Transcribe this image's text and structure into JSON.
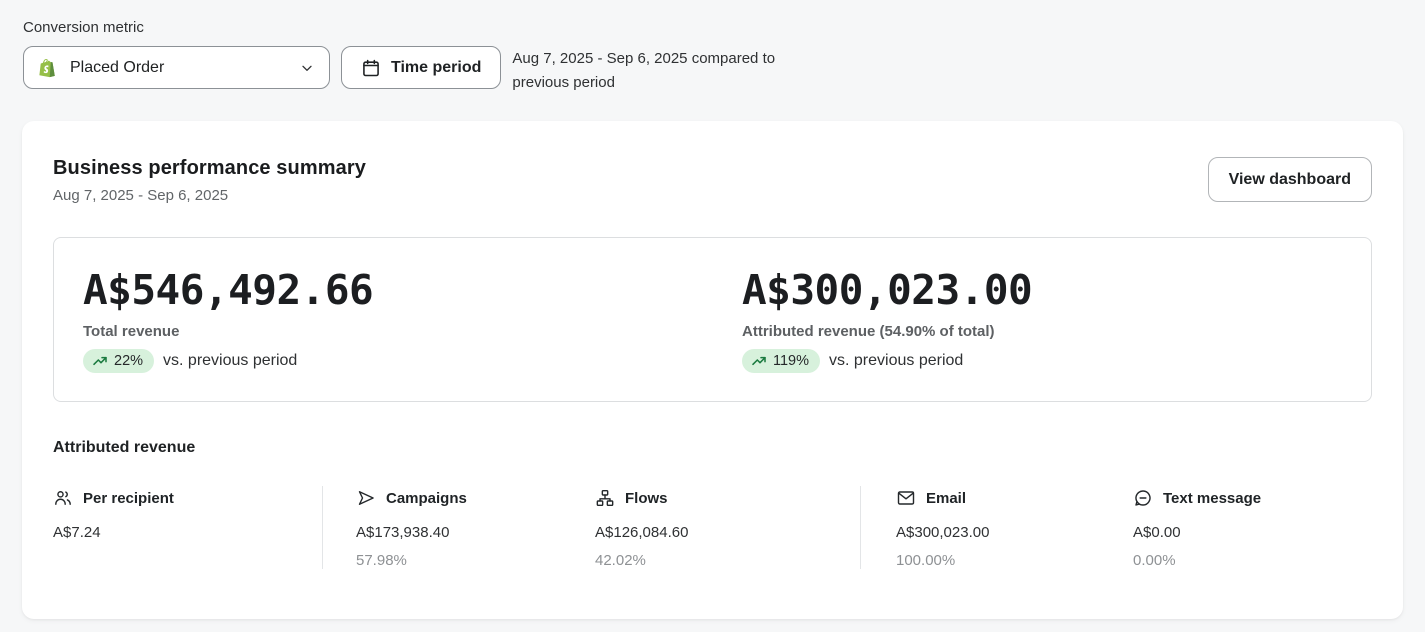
{
  "controls": {
    "label": "Conversion metric",
    "metric_dropdown": {
      "value": "Placed Order",
      "icon": "shopify-icon"
    },
    "time_period_button": {
      "label": "Time period",
      "icon": "calendar-icon"
    },
    "date_range_text": "Aug 7, 2025 - Sep 6, 2025 compared to previous period"
  },
  "summary_card": {
    "title": "Business performance summary",
    "date_range": "Aug 7, 2025 - Sep 6, 2025",
    "view_dashboard_button": "View dashboard",
    "metrics": [
      {
        "value": "A$546,492.66",
        "label": "Total revenue",
        "change": "22%",
        "change_direction": "up",
        "change_suffix": "vs. previous period"
      },
      {
        "value": "A$300,023.00",
        "label": "Attributed revenue (54.90% of total)",
        "change": "119%",
        "change_direction": "up",
        "change_suffix": "vs. previous period"
      }
    ],
    "attributed_revenue": {
      "heading": "Attributed revenue",
      "columns": [
        {
          "icon": "people-icon",
          "label": "Per recipient",
          "value": "A$7.24",
          "percent": ""
        },
        {
          "icon": "send-icon",
          "label": "Campaigns",
          "value": "A$173,938.40",
          "percent": "57.98%"
        },
        {
          "icon": "flow-icon",
          "label": "Flows",
          "value": "A$126,084.60",
          "percent": "42.02%"
        },
        {
          "icon": "email-icon",
          "label": "Email",
          "value": "A$300,023.00",
          "percent": "100.00%"
        },
        {
          "icon": "message-icon",
          "label": "Text message",
          "value": "A$0.00",
          "percent": "0.00%"
        }
      ]
    }
  },
  "colors": {
    "page_background": "#f6f7f8",
    "badge_background": "#d7f1dc",
    "badge_arrow_green": "#1a7a3f",
    "shopify_green": "#96bf48",
    "shopify_green_dark": "#5e8e3e"
  }
}
